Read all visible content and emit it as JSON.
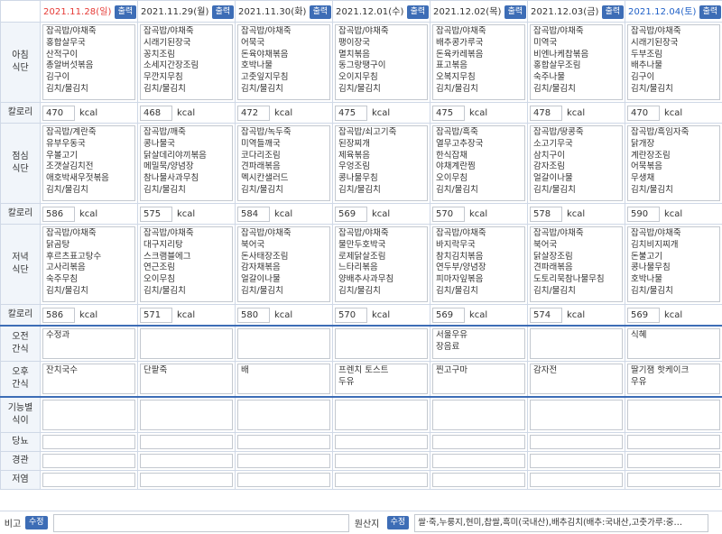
{
  "days": [
    {
      "date": "2021.11.28(일)",
      "kind": "sun"
    },
    {
      "date": "2021.11.29(월)",
      "kind": "wk"
    },
    {
      "date": "2021.11.30(화)",
      "kind": "wk"
    },
    {
      "date": "2021.12.01(수)",
      "kind": "wk"
    },
    {
      "date": "2021.12.02(목)",
      "kind": "wk"
    },
    {
      "date": "2021.12.03(금)",
      "kind": "wk"
    },
    {
      "date": "2021.12.04(토)",
      "kind": "sat"
    }
  ],
  "print_label": "출력",
  "kcal_unit": "kcal",
  "labels": {
    "breakfast": [
      "아침",
      "식단"
    ],
    "lunch": [
      "점심",
      "식단"
    ],
    "dinner": [
      "저녁",
      "식단"
    ],
    "calorie": "칼로리",
    "am_snack": [
      "오전",
      "간식"
    ],
    "pm_snack": [
      "오후",
      "간식"
    ],
    "functional": [
      "기능별",
      "식이"
    ],
    "diabetes": "당뇨",
    "tube": "경관",
    "lowsalt": "저염"
  },
  "breakfast": [
    [
      "잡곡밥/야채죽",
      "홍합살무국",
      "산적구이",
      "총알버섯볶음",
      "김구이",
      "김치/물김치"
    ],
    [
      "잡곡밥/야채죽",
      "시래기된장국",
      "꽁치조림",
      "소세지간장조림",
      "무깐지무침",
      "김치/물김치"
    ],
    [
      "잡곡밥/야채죽",
      "어묵국",
      "돈육야채볶음",
      "호박나물",
      "고춧잎지무침",
      "김치/물김치"
    ],
    [
      "잡곡밥/야채죽",
      "팽이장국",
      "멸치볶음",
      "동그랑땡구이",
      "오이지무침",
      "김치/물김치"
    ],
    [
      "잡곡밥/야채죽",
      "배추콩가루국",
      "돈육카레볶음",
      "표고볶음",
      "오복지무침",
      "김치/물김치"
    ],
    [
      "잡곡밥/야채죽",
      "미역국",
      "비엔나케찹볶음",
      "홍합살무조림",
      "숙주나물",
      "김치/물김치"
    ],
    [
      "잡곡밥/야채죽",
      "시래기된장국",
      "두부조림",
      "배추나물",
      "김구이",
      "김치/물김치"
    ]
  ],
  "breakfast_kcal": [
    "470",
    "468",
    "472",
    "475",
    "475",
    "478",
    "470"
  ],
  "lunch": [
    [
      "잡곡밥/계란죽",
      "유부우동국",
      "우볼고기",
      "조갯살김치전",
      "애호박새우젓볶음",
      "김치/물김치"
    ],
    [
      "잡곡밥/깨죽",
      "콩나물국",
      "닭살데리야끼볶음",
      "메밀묵/양념장",
      "참나물사과무침",
      "김치/물김치"
    ],
    [
      "잡곡밥/녹두죽",
      "미역들깨국",
      "코다리조림",
      "견파래볶음",
      "멕시칸샐러드",
      "김치/물김치"
    ],
    [
      "잡곡밥/쇠고기죽",
      "된장찌개",
      "제육볶음",
      "우엉조림",
      "콩나물무침",
      "김치/물김치"
    ],
    [
      "잡곡밥/흑죽",
      "열무고추장국",
      "한식잡채",
      "야채계란찜",
      "오이무침",
      "김치/물김치"
    ],
    [
      "잡곡밥/땅콩죽",
      "소고기무국",
      "삼치구이",
      "감자조림",
      "얼갈이나물",
      "김치/물김치"
    ],
    [
      "잡곡밥/흑임자죽",
      "닭개장",
      "계란장조림",
      "어묵볶음",
      "무생채",
      "김치/물김치"
    ]
  ],
  "lunch_kcal": [
    "586",
    "575",
    "584",
    "569",
    "570",
    "578",
    "590"
  ],
  "dinner": [
    [
      "잡곡밥/야채죽",
      "닭곰탕",
      "후르츠표고탕수",
      "고사리볶음",
      "숙주무침",
      "김치/물김치"
    ],
    [
      "잡곡밥/야채죽",
      "대구지리탕",
      "스크램블에그",
      "연근조림",
      "오이무침",
      "김치/물김치"
    ],
    [
      "잡곡밥/야채죽",
      "북어국",
      "돈사태장조림",
      "감자채볶음",
      "얼갈이나물",
      "김치/물김치"
    ],
    [
      "잡곡밥/야채죽",
      "물만두호박국",
      "로제닭살조림",
      "느타리볶음",
      "양배추사과무침",
      "김치/물김치"
    ],
    [
      "잡곡밥/야채죽",
      "바지락무국",
      "참치김치볶음",
      "연두부/양념장",
      "피마자잎볶음",
      "김치/물김치"
    ],
    [
      "잡곡밥/야채죽",
      "북어국",
      "닭살장조림",
      "견파래볶음",
      "도토리묵참나물무침",
      "김치/물김치"
    ],
    [
      "잡곡밥/야채죽",
      "김치비지찌개",
      "돈불고기",
      "콩나물무침",
      "호박나물",
      "김치/물김치"
    ]
  ],
  "dinner_kcal": [
    "586",
    "571",
    "580",
    "570",
    "569",
    "574",
    "569"
  ],
  "am_snack": [
    [
      "수정과"
    ],
    [],
    [],
    [],
    [
      "서울우유",
      "장음료"
    ],
    [],
    [
      "식혜"
    ]
  ],
  "pm_snack": [
    [
      "잔치국수"
    ],
    [
      "단팥죽"
    ],
    [
      "배"
    ],
    [
      "프렌치 토스트",
      "두유"
    ],
    [
      "찐고구마"
    ],
    [
      "감자전"
    ],
    [
      "딸기잼 핫케이크",
      "우유"
    ]
  ],
  "footer": {
    "note_label": "비고",
    "edit_label": "수정",
    "origin_label": "원산지",
    "origin_edit_label": "수정",
    "origin_text": "쌀·죽,누룽지,현미,찹쌀,흑미(국내산),배추김치(배추:국내산,고춧가루:중…"
  }
}
